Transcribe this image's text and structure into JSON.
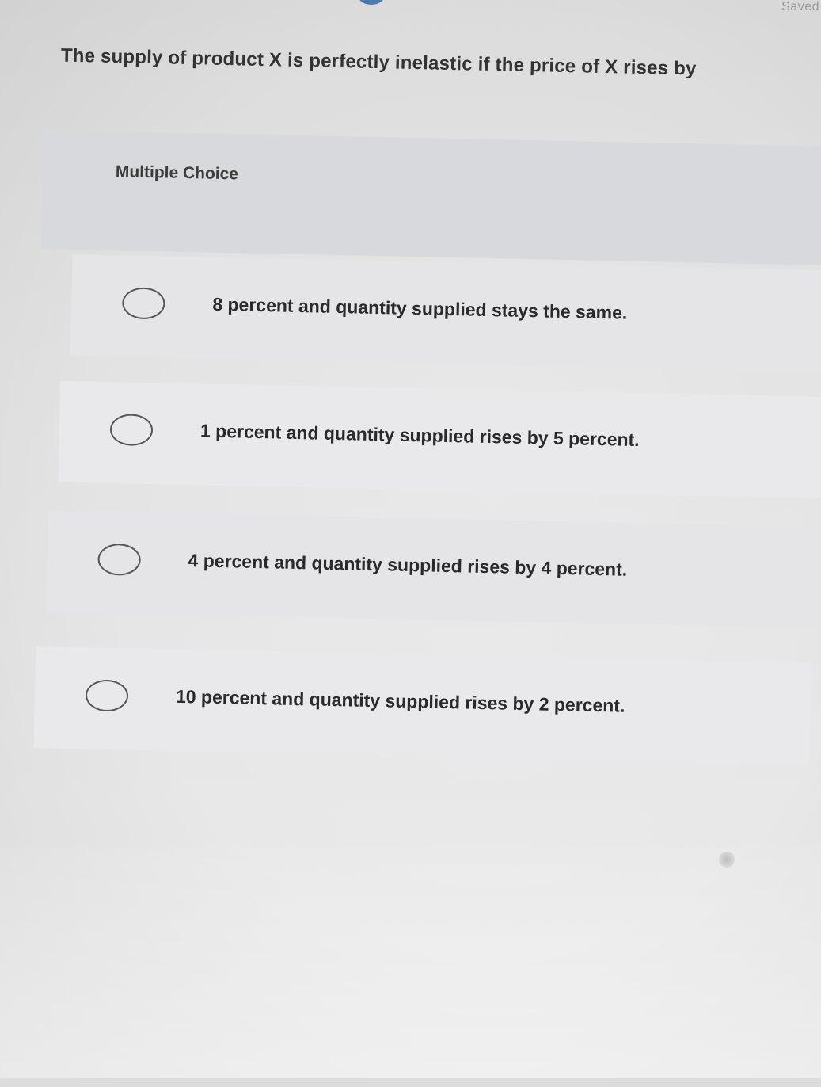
{
  "header": {
    "status": "Saved"
  },
  "question": {
    "text": "The supply of product X is perfectly inelastic if the price of X rises by",
    "type_label": "Multiple Choice"
  },
  "options": [
    {
      "label": "8 percent and quantity supplied stays the same."
    },
    {
      "label": "1 percent and quantity supplied rises by 5 percent."
    },
    {
      "label": "4 percent and quantity supplied rises by 4 percent."
    },
    {
      "label": "10 percent and quantity supplied rises by 2 percent."
    }
  ]
}
